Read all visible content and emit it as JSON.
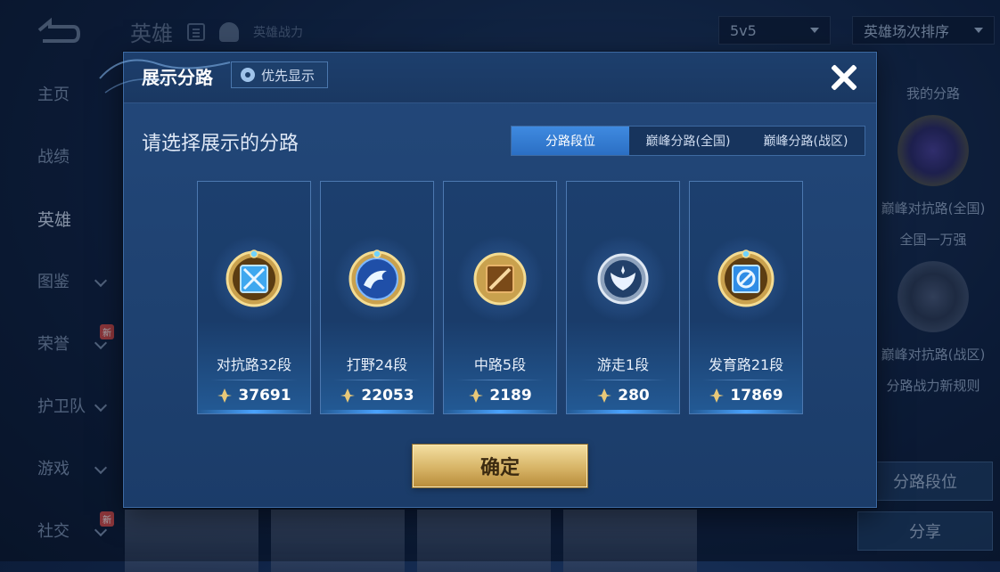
{
  "background": {
    "header_title": "英雄",
    "header_sub": "英雄战力",
    "mode_select": "5v5",
    "sort_select": "英雄场次排序",
    "nav": [
      {
        "label": "主页",
        "chevron": false,
        "new": false,
        "active": false
      },
      {
        "label": "战绩",
        "chevron": false,
        "new": false,
        "active": false
      },
      {
        "label": "英雄",
        "chevron": false,
        "new": false,
        "active": true
      },
      {
        "label": "图鉴",
        "chevron": true,
        "new": false,
        "active": false
      },
      {
        "label": "荣誉",
        "chevron": true,
        "new": true,
        "active": false
      },
      {
        "label": "护卫队",
        "chevron": true,
        "new": false,
        "active": false
      },
      {
        "label": "游戏",
        "chevron": true,
        "new": false,
        "active": false
      },
      {
        "label": "社交",
        "chevron": true,
        "new": true,
        "active": false
      }
    ],
    "new_badge": "新",
    "right_panel": {
      "my_lane": "我的分路",
      "label1": "巅峰对抗路(全国)",
      "label2": "全国一万强",
      "label3": "巅峰对抗路(战区)",
      "rule_link": "分路战力新规则",
      "lane_rank_button": "分路段位",
      "share_button": "分享"
    }
  },
  "modal": {
    "title": "展示分路",
    "priority_button": "优先显示",
    "prompt": "请选择展示的分路",
    "tabs": [
      {
        "label": "分路段位",
        "active": true
      },
      {
        "label": "巅峰分路(全国)",
        "active": false
      },
      {
        "label": "巅峰分路(战区)",
        "active": false
      }
    ],
    "lanes": [
      {
        "label": "对抗路32段",
        "power": "37691",
        "icon": "sword-shield-icon",
        "color": "#3fa8ef"
      },
      {
        "label": "打野24段",
        "power": "22053",
        "icon": "dragon-icon",
        "color": "#2f6fcf"
      },
      {
        "label": "中路5段",
        "power": "2189",
        "icon": "slash-icon",
        "color": "#c87a2c"
      },
      {
        "label": "游走1段",
        "power": "280",
        "icon": "wings-icon",
        "color": "#9fb4cc"
      },
      {
        "label": "发育路21段",
        "power": "17869",
        "icon": "target-icon",
        "color": "#2f8de6"
      }
    ],
    "confirm_button": "确定"
  },
  "colors": {
    "accent_blue": "#2b6fc4",
    "gold": "#d7b466",
    "modal_bg": "#1f4372"
  }
}
